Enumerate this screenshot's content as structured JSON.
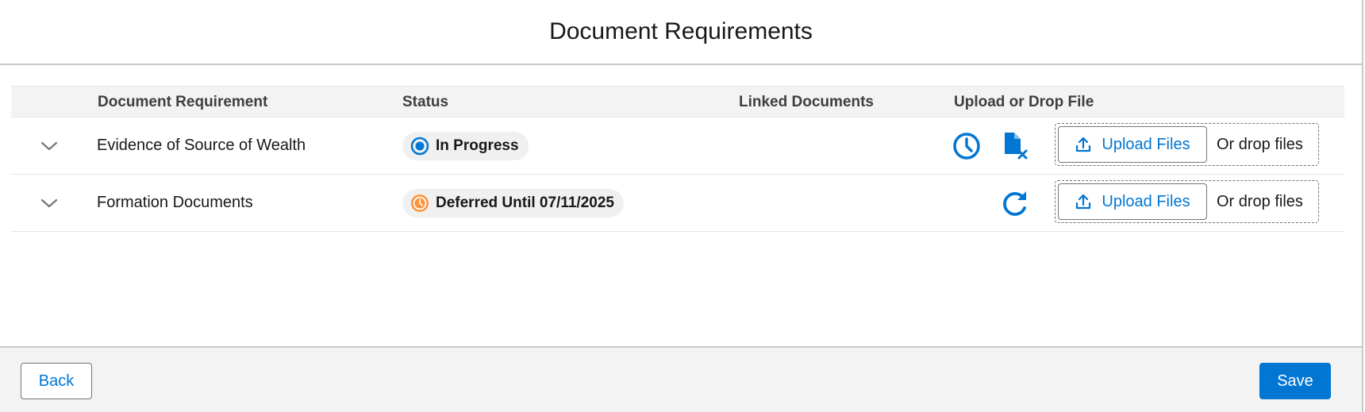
{
  "modal": {
    "title": "Document Requirements"
  },
  "table": {
    "headers": {
      "requirement": "Document Requirement",
      "status": "Status",
      "linked": "Linked Documents",
      "upload": "Upload or Drop File"
    },
    "rows": [
      {
        "name": "Evidence of Source of Wealth",
        "status": "In Progress",
        "status_icon": "in-progress-icon",
        "status_color": "#0176d3",
        "upload_label": "Upload Files",
        "drop_label": "Or drop files"
      },
      {
        "name": "Formation Documents",
        "status": "Deferred Until 07/11/2025",
        "status_icon": "clock-icon",
        "status_color": "#fe9339",
        "upload_label": "Upload Files",
        "drop_label": "Or drop files"
      }
    ]
  },
  "footer": {
    "back_label": "Back",
    "save_label": "Save"
  },
  "colors": {
    "brand": "#0176d3",
    "warning": "#fe9339"
  }
}
